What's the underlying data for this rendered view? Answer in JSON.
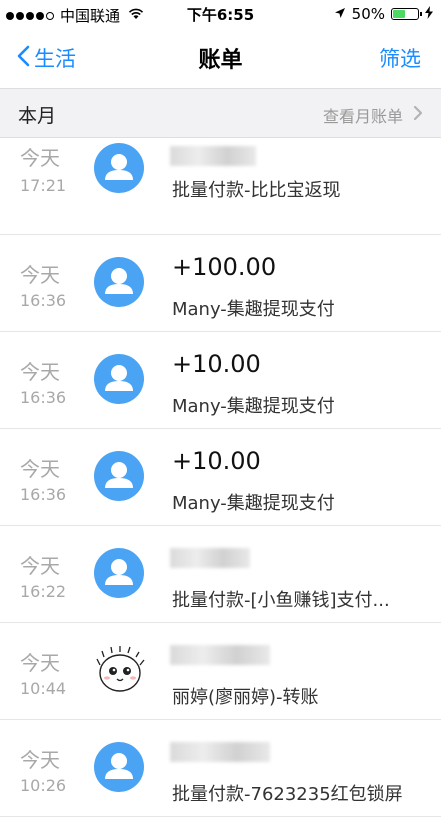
{
  "status_bar": {
    "carrier": "中国联通",
    "time": "下午6:55",
    "battery_percent": "50%",
    "battery_level": 0.5
  },
  "nav": {
    "back_label": "生活",
    "title": "账单",
    "filter_label": "筛选"
  },
  "month_header": {
    "label": "本月",
    "view_monthly": "查看月账单"
  },
  "transactions": [
    {
      "day": "今天",
      "time": "17:21",
      "amount": "",
      "description": "批量付款-比比宝返现",
      "avatar": "user-icon"
    },
    {
      "day": "今天",
      "time": "16:36",
      "amount": "+100.00",
      "description": "Many-集趣提现支付",
      "avatar": "user-icon"
    },
    {
      "day": "今天",
      "time": "16:36",
      "amount": "+10.00",
      "description": "Many-集趣提现支付",
      "avatar": "user-icon"
    },
    {
      "day": "今天",
      "time": "16:36",
      "amount": "+10.00",
      "description": "Many-集趣提现支付",
      "avatar": "user-icon"
    },
    {
      "day": "今天",
      "time": "16:22",
      "amount": "",
      "description": "批量付款-[小鱼赚钱]支付...",
      "avatar": "user-icon"
    },
    {
      "day": "今天",
      "time": "10:44",
      "amount": "",
      "description": "丽婷(廖丽婷)-转账",
      "avatar": "cat-avatar"
    },
    {
      "day": "今天",
      "time": "10:26",
      "amount": "",
      "description": "批量付款-7623235红包锁屏",
      "avatar": "user-icon"
    }
  ]
}
